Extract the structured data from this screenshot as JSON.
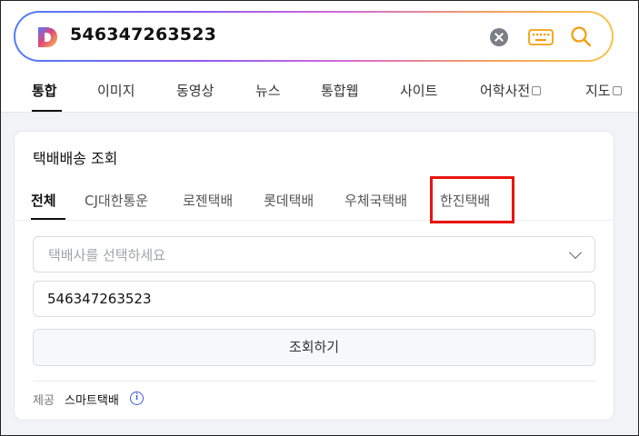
{
  "search": {
    "query": "546347263523"
  },
  "nav_tabs": [
    {
      "label": "통합",
      "active": true
    },
    {
      "label": "이미지"
    },
    {
      "label": "동영상"
    },
    {
      "label": "뉴스"
    },
    {
      "label": "통합웹"
    },
    {
      "label": "사이트"
    },
    {
      "label": "어학사전"
    },
    {
      "label": "지도"
    }
  ],
  "card": {
    "title": "택배배송 조회",
    "carrier_tabs": [
      "전체",
      "CJ대한통운",
      "로젠택배",
      "롯데택배",
      "우체국택배",
      "한진택배"
    ],
    "active_carrier": "전체",
    "highlighted_carrier": "한진택배",
    "select_placeholder": "택배사를 선택하세요",
    "tracking_value": "546347263523",
    "submit_label": "조회하기",
    "provider_label": "제공",
    "provider_name": "스마트택배",
    "info_glyph": "i"
  },
  "colors": {
    "highlight": "#e8140f",
    "brand_gradient": [
      "#4f7cff",
      "#8a5cf6",
      "#d36ad8",
      "#f3a35b",
      "#f7c34a"
    ],
    "search_icon": "#f59e0b",
    "info_icon": "#3b5bdb"
  }
}
